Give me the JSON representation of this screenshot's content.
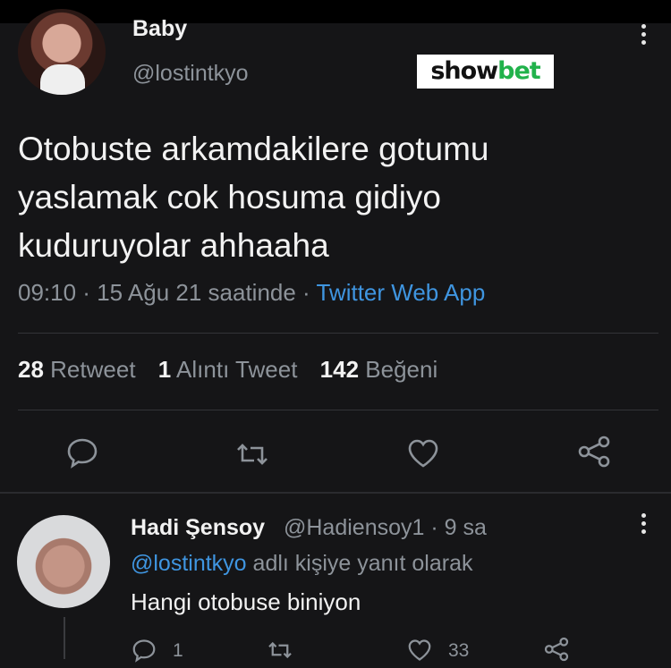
{
  "tweet": {
    "display_name": "Baby",
    "handle": "@lostintkyo",
    "text": "Otobuste arkamdakilere gotumu\nyaslamak cok hosuma gidiyo\nkuduruyolar ahhaaha",
    "time": "09:10",
    "date": "15 Ağu 21 saatinde",
    "separator": " · ",
    "source": "Twitter Web App",
    "retweets_count": "28",
    "retweets_label": "Retweet",
    "quotes_count": "1",
    "quotes_label": "Alıntı Tweet",
    "likes_count": "142",
    "likes_label": "Beğeni"
  },
  "watermark": {
    "part1": "show",
    "part2": "bet",
    "color2": "#21b24b"
  },
  "reply": {
    "display_name": "Hadi Şensoy",
    "handle": "@Hadiensoy1",
    "age": "· 9 sa",
    "reply_to_mention": "@lostintkyo",
    "reply_to_suffix": " adlı kişiye yanıt olarak",
    "text": "Hangi otobuse biniyon",
    "reply_count": "1",
    "like_count": "33"
  },
  "icons": [
    "reply-icon",
    "retweet-icon",
    "like-icon",
    "share-icon",
    "more-options-icon"
  ],
  "colors": {
    "background": "#151517",
    "link": "#3f95e0",
    "muted": "#8d939a"
  }
}
